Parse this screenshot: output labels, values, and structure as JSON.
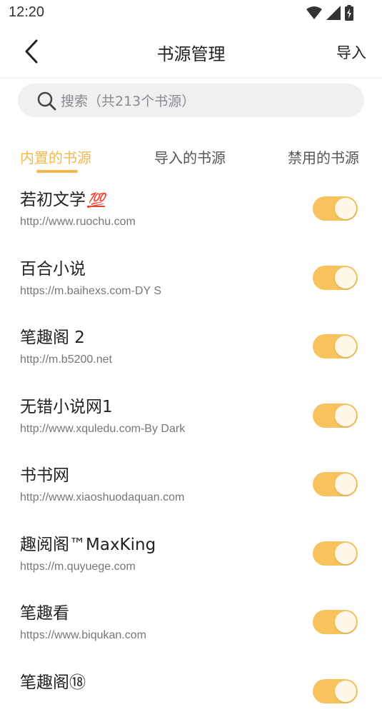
{
  "status_bar": {
    "time": "12:20"
  },
  "app_bar": {
    "title": "书源管理",
    "import_label": "导入"
  },
  "search": {
    "placeholder": "搜索（共213个书源）"
  },
  "tabs": [
    {
      "label": "内置的书源",
      "active": true
    },
    {
      "label": "导入的书源",
      "active": false
    },
    {
      "label": "禁用的书源",
      "active": false
    }
  ],
  "colors": {
    "accent": "#f5b84a",
    "toggle_on": "#f8c25c"
  },
  "sources": [
    {
      "name": "若初文学",
      "badge": "💯",
      "url": "http://www.ruochu.com",
      "enabled": true
    },
    {
      "name": "百合小说",
      "url": "https://m.baihexs.com-DY S",
      "enabled": true
    },
    {
      "name": "笔趣阁 2",
      "url": "http://m.b5200.net",
      "enabled": true
    },
    {
      "name": "无错小说网1",
      "url": "http://www.xquledu.com-By Dark",
      "enabled": true
    },
    {
      "name": "书书网",
      "url": "http://www.xiaoshuodaquan.com",
      "enabled": true
    },
    {
      "name": "趣阅阁™MaxKing",
      "url": "https://m.quyuege.com",
      "enabled": true
    },
    {
      "name": "笔趣看",
      "url": "https://www.biqukan.com",
      "enabled": true
    },
    {
      "name": "笔趣阁⑱",
      "url": "",
      "enabled": true
    }
  ]
}
